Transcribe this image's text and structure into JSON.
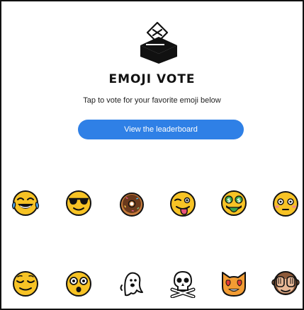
{
  "app": {
    "title": "EMOJI VOTE",
    "subtitle": "Tap to vote for your favorite emoji below",
    "leaderboard_button": "View the leaderboard",
    "logo_icon": "ballot-box-icon"
  },
  "colors": {
    "accent": "#2f80e6",
    "emoji_yellow": "#f7c325",
    "outline": "#111111"
  },
  "emoji_rows": [
    [
      "face-with-tears-of-joy-icon",
      "smiling-face-with-sunglasses-icon",
      "doughnut-icon",
      "winking-face-with-tongue-icon",
      "money-mouth-face-icon",
      "flushed-face-icon"
    ],
    [
      "relieved-face-icon",
      "astonished-face-icon",
      "ghost-icon",
      "skull-and-crossbones-icon",
      "smiling-cat-with-heart-eyes-icon",
      "see-no-evil-monkey-icon"
    ]
  ]
}
